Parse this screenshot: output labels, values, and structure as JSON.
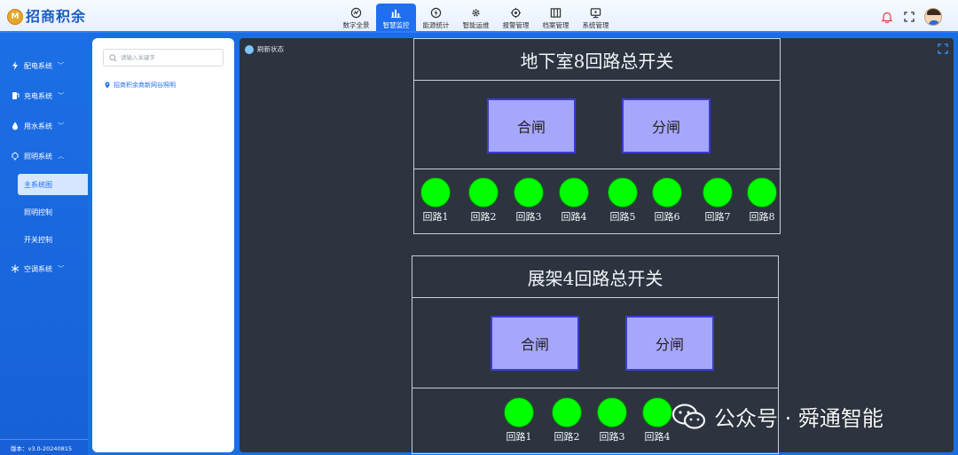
{
  "header": {
    "logo_badge": "M",
    "logo_text": "招商积余",
    "nav": [
      {
        "label": "数字全景",
        "icon": "dashboard-icon"
      },
      {
        "label": "智慧监控",
        "icon": "bar-chart-icon",
        "active": true
      },
      {
        "label": "能源统计",
        "icon": "energy-icon"
      },
      {
        "label": "智能运维",
        "icon": "gear-icon"
      },
      {
        "label": "报警管理",
        "icon": "alarm-gear-icon"
      },
      {
        "label": "档案管理",
        "icon": "archive-icon"
      },
      {
        "label": "系统管理",
        "icon": "monitor-icon"
      }
    ]
  },
  "sidebar": {
    "menus": [
      {
        "label": "配电系统",
        "icon": "lightning-icon",
        "caret": "﹀"
      },
      {
        "label": "充电系统",
        "icon": "charger-icon",
        "caret": "﹀"
      },
      {
        "label": "用水系统",
        "icon": "water-drop-icon",
        "caret": "﹀"
      },
      {
        "label": "照明系统",
        "icon": "lighting-icon",
        "caret": "︿"
      },
      {
        "label": "空调系统",
        "icon": "snowflake-icon",
        "caret": "﹀"
      }
    ],
    "sub_items": [
      {
        "label": "主系统图",
        "active": true
      },
      {
        "label": "照明控制"
      },
      {
        "label": "开关控制"
      }
    ],
    "version": "版本：v3.0-20240815"
  },
  "tree": {
    "search_placeholder": "请输入关键字",
    "node_label": "招商积余商新网谷照明"
  },
  "main": {
    "refresh_label": "刷新状态",
    "panels": [
      {
        "title": "地下室8回路总开关",
        "close_label": "合闸",
        "open_label": "分闸",
        "circuits": [
          "回路1",
          "回路2",
          "回路3",
          "回路4",
          "回路5",
          "回路6",
          "回路7",
          "回路8"
        ]
      },
      {
        "title": "展架4回路总开关",
        "close_label": "合闸",
        "open_label": "分闸",
        "circuits": [
          "回路1",
          "回路2",
          "回路3",
          "回路4"
        ]
      }
    ]
  },
  "watermark": {
    "text": "公众号 · 舜通智能"
  },
  "colors": {
    "accent": "#1f6ff0",
    "canvas": "#2d3440",
    "gate_button": "#a6a6fb",
    "circuit_on": "#00ff00"
  }
}
